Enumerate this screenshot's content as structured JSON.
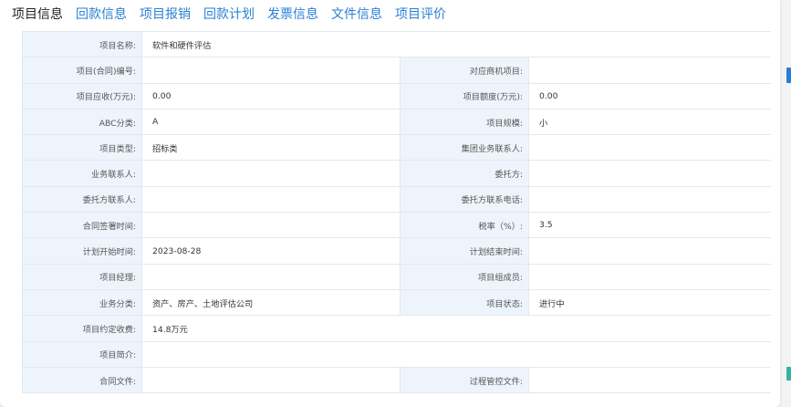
{
  "tabs": [
    "项目信息",
    "回款信息",
    "项目报销",
    "回款计划",
    "发票信息",
    "文件信息",
    "项目评价"
  ],
  "active_tab": 0,
  "rows": [
    {
      "type": "full",
      "label": "项目名称:",
      "value": "软件和硬件评估"
    },
    {
      "type": "pair",
      "label1": "项目(合同)编号:",
      "value1": "",
      "label2": "对应商机项目:",
      "value2": ""
    },
    {
      "type": "pair",
      "label1": "项目应收(万元):",
      "value1": "0.00",
      "label2": "项目额度(万元):",
      "value2": "0.00"
    },
    {
      "type": "pair",
      "label1": "ABC分类:",
      "value1": "A",
      "label2": "项目规模:",
      "value2": "小"
    },
    {
      "type": "pair",
      "label1": "项目类型:",
      "value1": "招标类",
      "label2": "集团业务联系人:",
      "value2": ""
    },
    {
      "type": "pair",
      "label1": "业务联系人:",
      "value1": "",
      "label2": "委托方:",
      "value2": ""
    },
    {
      "type": "pair",
      "label1": "委托方联系人:",
      "value1": "",
      "label2": "委托方联系电话:",
      "value2": ""
    },
    {
      "type": "pair",
      "label1": "合同签署时间:",
      "value1": "",
      "label2": "税率（%）:",
      "value2": "3.5"
    },
    {
      "type": "pair",
      "label1": "计划开始时间:",
      "value1": "2023-08-28",
      "label2": "计划结束时间:",
      "value2": ""
    },
    {
      "type": "pair",
      "label1": "项目经理:",
      "value1": "",
      "label2": "项目组成员:",
      "value2": ""
    },
    {
      "type": "pair",
      "label1": "业务分类:",
      "value1": "资产、房产、土地评估公司",
      "label2": "项目状态:",
      "value2": "进行中"
    },
    {
      "type": "full",
      "label": "项目约定收费:",
      "value": "14.8万元"
    },
    {
      "type": "full",
      "label": "项目简介:",
      "value": ""
    },
    {
      "type": "pair",
      "label1": "合同文件:",
      "value1": "",
      "label2": "过程管控文件:",
      "value2": ""
    }
  ],
  "colors": {
    "accent": "#2a7fd4",
    "label_bg": "#eef4fb",
    "border": "#e2e8ef"
  }
}
